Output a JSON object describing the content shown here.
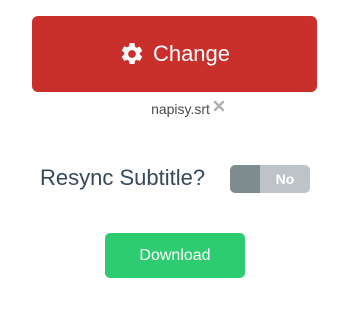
{
  "change_button": {
    "label": "Change",
    "icon": "gear-icon",
    "color": "#c9302c"
  },
  "file": {
    "name": "napisy.srt",
    "remove_icon": "close-icon"
  },
  "resync": {
    "label": "Resync Subtitle?",
    "toggle_state": "No"
  },
  "download_button": {
    "label": "Download",
    "color": "#2ecc71"
  }
}
